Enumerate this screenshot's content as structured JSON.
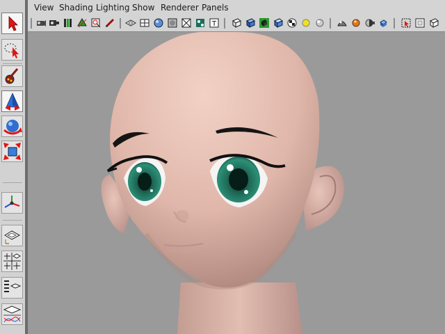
{
  "app": {
    "menus": [
      "View",
      "Shading",
      "Lighting",
      "Show",
      "Renderer",
      "Panels"
    ]
  },
  "toolbox": {
    "tools": [
      {
        "name": "select-tool",
        "icon": "select-arrow-icon"
      },
      {
        "name": "lasso-tool",
        "icon": "lasso-icon"
      },
      {
        "name": "paint-tool",
        "icon": "paint-brush-icon"
      },
      {
        "name": "move-tool",
        "icon": "move-cone-icon"
      },
      {
        "name": "rotate-tool",
        "icon": "rotate-sphere-icon"
      },
      {
        "name": "scale-tool",
        "icon": "scale-cube-icon"
      },
      {
        "name": "manipulator-tool",
        "icon": "universal-manipulator-icon"
      }
    ],
    "layouts": [
      "single-view-layout",
      "four-view-layout",
      "outliner-layout",
      "graph-layout"
    ]
  },
  "viewport": {
    "content": "3D anime character head model",
    "colors": {
      "skin": "#e3bdb1",
      "iris": "#1f6a57",
      "background": "#9a9a9a"
    }
  }
}
